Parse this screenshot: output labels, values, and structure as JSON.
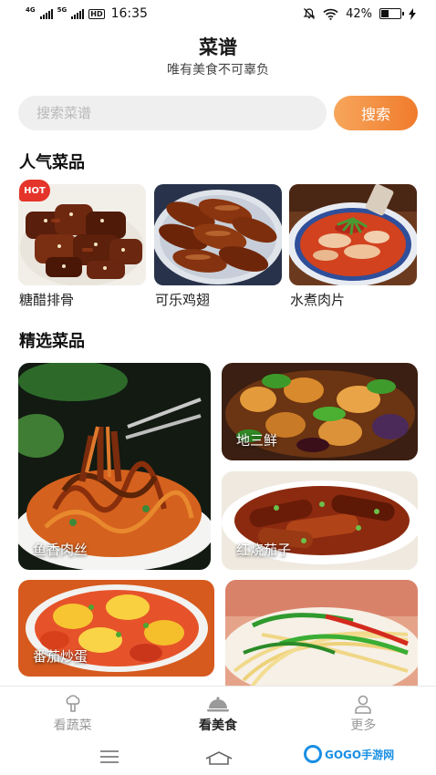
{
  "status_bar": {
    "network_1": "4G",
    "network_2": "5G",
    "hd": "HD",
    "time": "16:35",
    "battery_text": "42%",
    "battery_level": 0.42
  },
  "header": {
    "title": "菜谱",
    "subtitle": "唯有美食不可辜负"
  },
  "search": {
    "placeholder": "搜索菜谱",
    "value": "",
    "button_label": "搜索"
  },
  "popular": {
    "section_title": "人气菜品",
    "badge": "HOT",
    "items": [
      {
        "name": "糖醋排骨"
      },
      {
        "name": "可乐鸡翅"
      },
      {
        "name": "水煮肉片"
      }
    ]
  },
  "featured": {
    "section_title": "精选菜品",
    "items": [
      {
        "name": "鱼香肉丝"
      },
      {
        "name": "地三鲜"
      },
      {
        "name": "红烧茄子"
      },
      {
        "name": "番茄炒蛋"
      },
      {
        "name": ""
      }
    ]
  },
  "bottom_nav": {
    "items": [
      {
        "label": "看蔬菜",
        "icon": "broccoli-icon"
      },
      {
        "label": "看美食",
        "icon": "cloche-icon"
      },
      {
        "label": "更多",
        "icon": "person-icon"
      }
    ]
  },
  "system_nav": {
    "items": [
      "menu-icon",
      "home-icon"
    ]
  },
  "watermark": {
    "text": "GOGO手游网"
  },
  "colors": {
    "accent_orange": "#f07b2c",
    "hot_red": "#e5342a"
  }
}
